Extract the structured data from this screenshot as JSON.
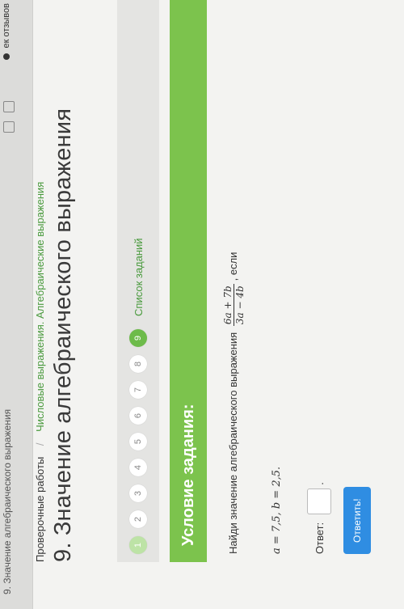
{
  "browser": {
    "tab_title": "9. Значение алгебраического выражения",
    "feedback_label": "ек отзывов"
  },
  "breadcrumb": {
    "first": "Проверочные работы",
    "separator": "/",
    "second": "Числовые выражения. Алгебраические выражения"
  },
  "page_title": "9. Значение алгебраического выражения",
  "steps": {
    "items": [
      "1",
      "2",
      "3",
      "4",
      "5",
      "6",
      "7",
      "8",
      "9"
    ],
    "active_index": 8,
    "task_list_label": "Список заданий"
  },
  "condition_header": "Условие задания:",
  "task": {
    "prefix": "Найди значение алгебраического выражения",
    "numerator": "6a + 7b",
    "denominator": "3a − 4b",
    "suffix": ", если",
    "values": "a = 7,5, b = 2,5."
  },
  "answer": {
    "label": "Ответ:",
    "value": "",
    "end": "."
  },
  "submit_label": "Ответить!",
  "colors": {
    "accent_green": "#7cc34d",
    "link_green": "#4a9a3e",
    "button_blue": "#2f8de2"
  }
}
